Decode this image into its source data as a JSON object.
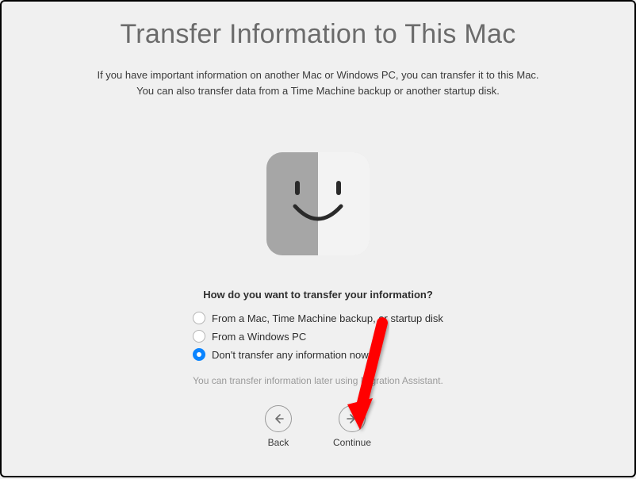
{
  "title": "Transfer Information to This Mac",
  "subtitle_line1": "If you have important information on another Mac or Windows PC, you can transfer it to this Mac.",
  "subtitle_line2": "You can also transfer data from a Time Machine backup or another startup disk.",
  "question": "How do you want to transfer your information?",
  "options": [
    {
      "label": "From a Mac, Time Machine backup, or startup disk",
      "selected": false
    },
    {
      "label": "From a Windows PC",
      "selected": false
    },
    {
      "label": "Don't transfer any information now",
      "selected": true
    }
  ],
  "hint": "You can transfer information later using Migration Assistant.",
  "nav": {
    "back": "Back",
    "continue": "Continue"
  }
}
